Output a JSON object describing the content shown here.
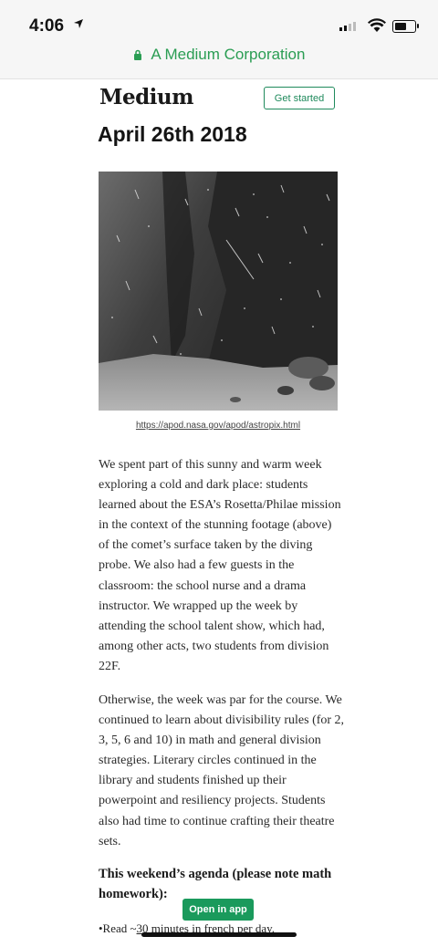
{
  "status_bar": {
    "time": "4:06"
  },
  "browser": {
    "url_label": "A Medium Corporation"
  },
  "header": {
    "brand": "Medium",
    "get_started_label": "Get started"
  },
  "post": {
    "title": "April 26th 2018",
    "image_caption": "https://apod.nasa.gov/apod/astropix.html",
    "paragraph_1": "We spent part of this sunny and warm week exploring a cold and dark place: students learned about the ESA’s Rosetta/Philae mission in the context of the stunning footage (above) of the comet’s surface taken by the diving probe. We also had a few guests in the classroom: the school nurse and a drama instructor. We wrapped up the week by attending the school talent show, which had, among other acts, two students from division 22F.",
    "paragraph_2": "Otherwise, the week was par for the course. We continued to learn about divisibility rules (for 2, 3, 5, 6 and 10) in math and general division strategies. Literary circles continued in the library and students finished up their powerpoint and resiliency projects. Students also had time to continue crafting their theatre sets.",
    "agenda_heading": "This weekend’s agenda (please note math homework):",
    "bullet_prefix": "•Read ~",
    "bullet_link": "30 minutes in french per day."
  },
  "open_in_app_label": "Open in app",
  "colors": {
    "accent": "#1a9a5c",
    "url_green": "#2a9d53"
  },
  "icons": [
    "location-arrow-icon",
    "signal-icon",
    "wifi-icon",
    "battery-icon",
    "lock-icon"
  ]
}
